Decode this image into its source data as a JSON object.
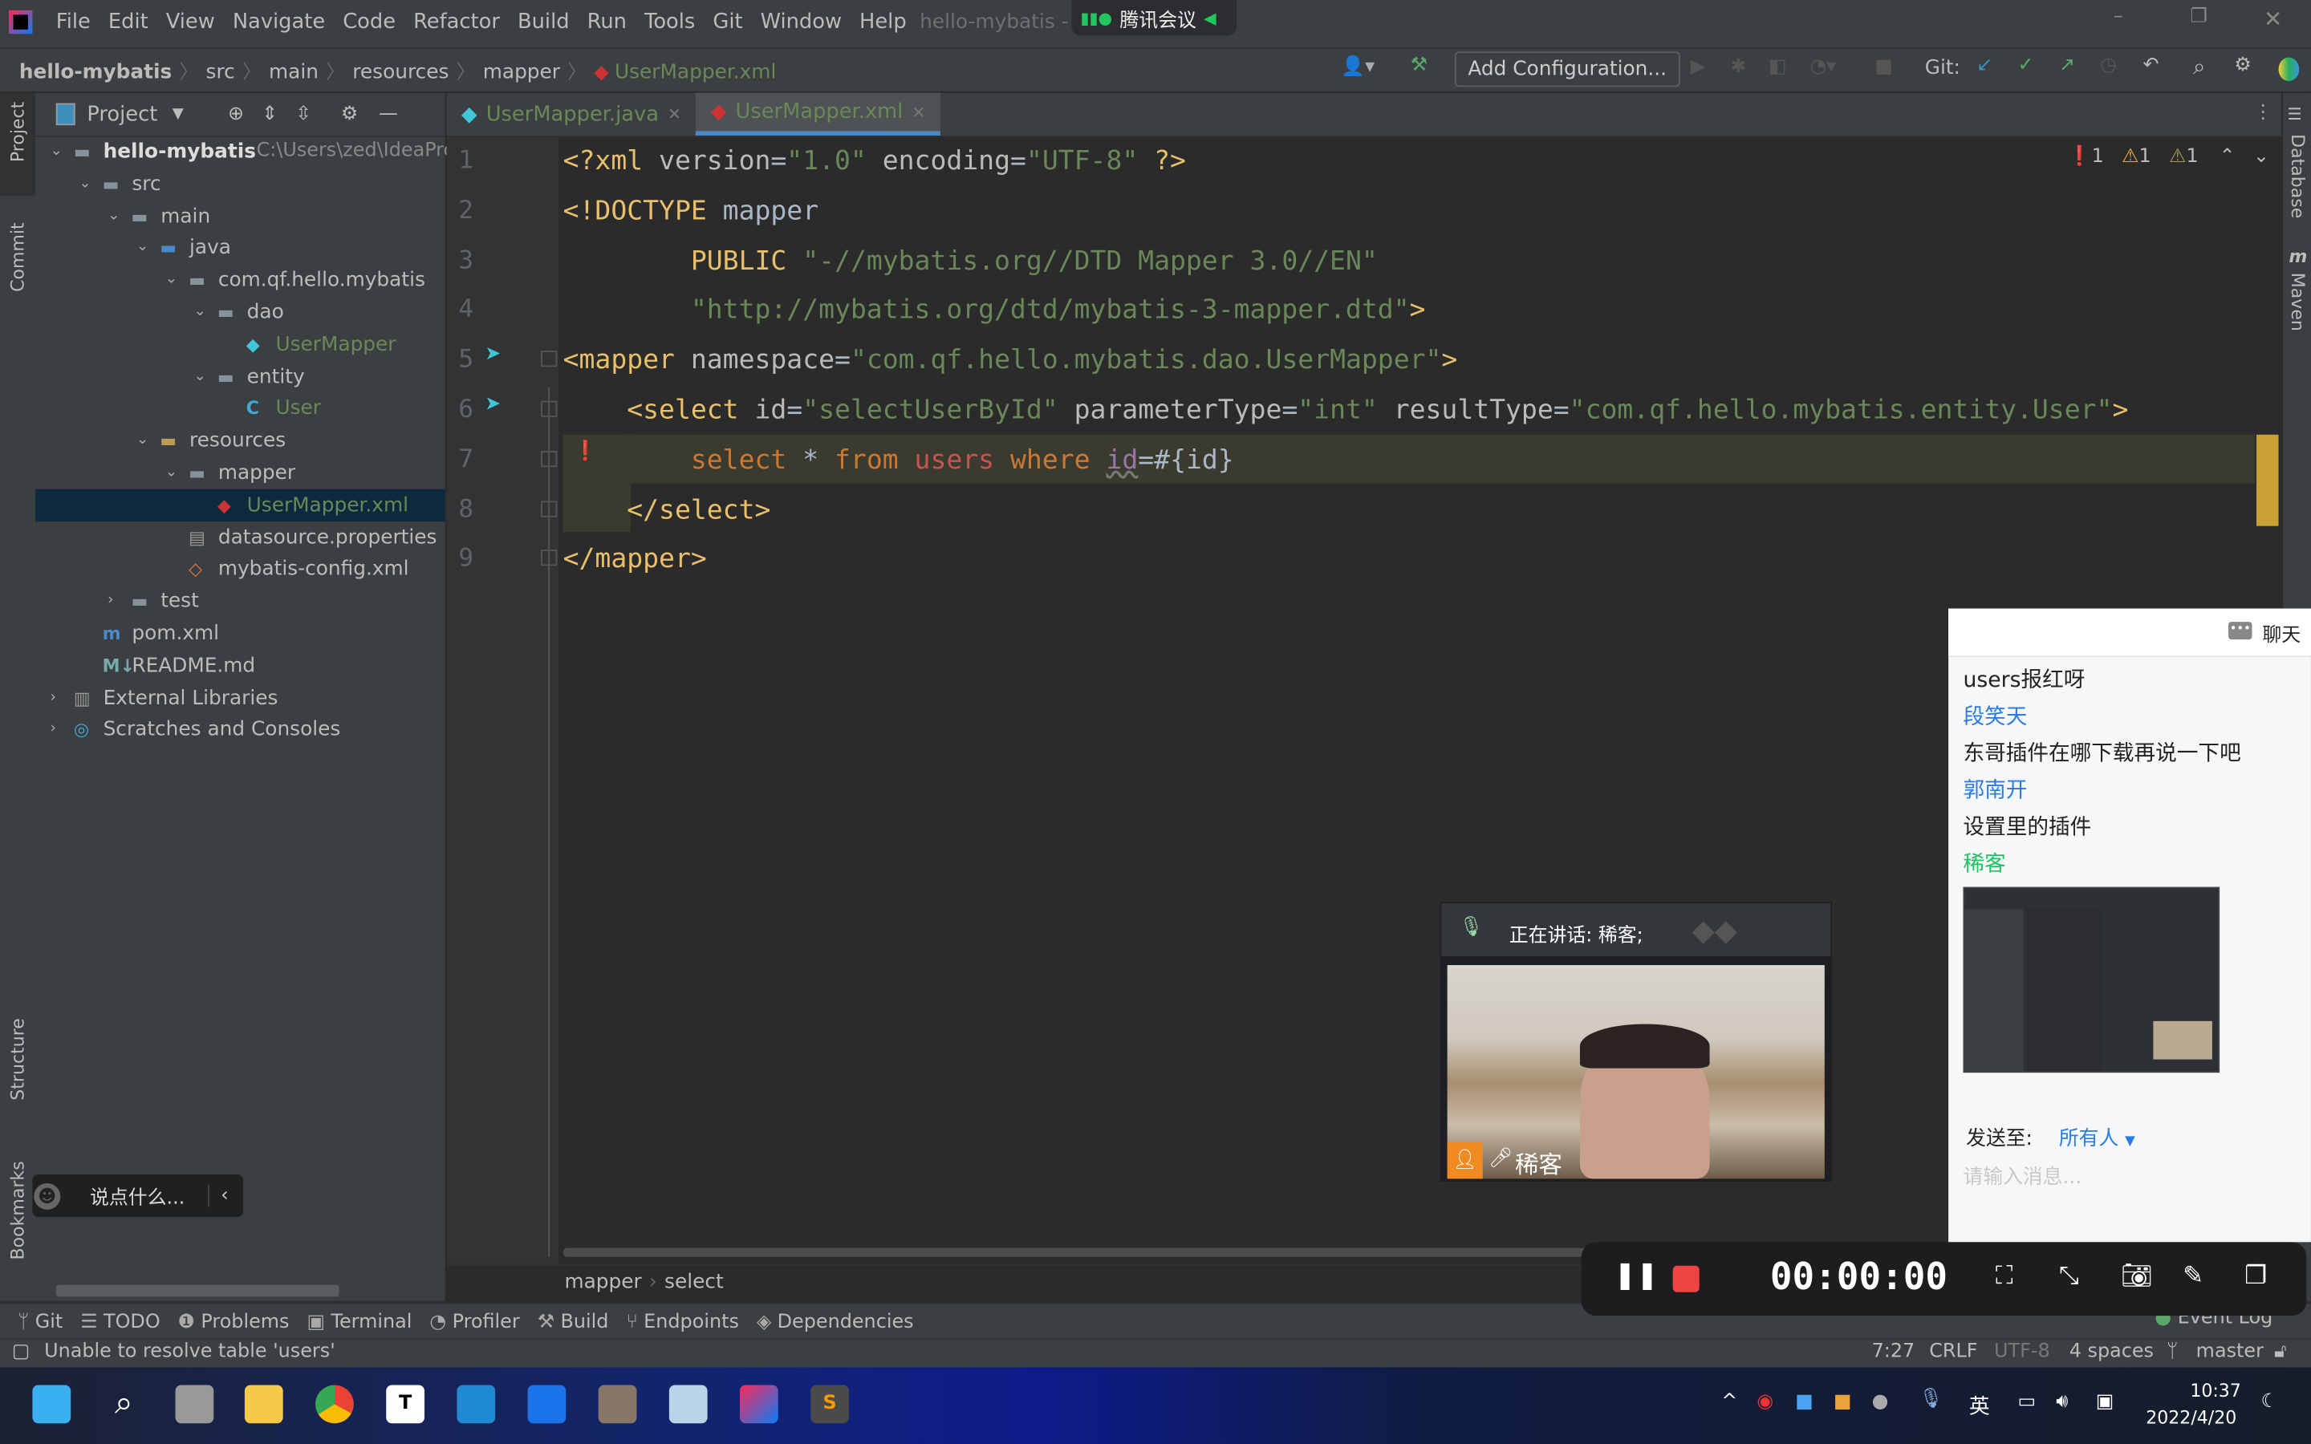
{
  "titlebar": {
    "menu": [
      "File",
      "Edit",
      "View",
      "Navigate",
      "Code",
      "Refactor",
      "Build",
      "Run",
      "Tools",
      "Git",
      "Window",
      "Help"
    ],
    "window_title": "hello-mybatis - UserMapper.xml",
    "meeting_app": "腾讯会议"
  },
  "navbar": {
    "breadcrumb": [
      "hello-mybatis",
      "src",
      "main",
      "resources",
      "mapper",
      "UserMapper.xml"
    ],
    "add_configuration": "Add Configuration...",
    "git_label": "Git:"
  },
  "left_stripe": {
    "project": "Project",
    "commit": "Commit",
    "structure": "Structure",
    "bookmarks": "Bookmarks"
  },
  "right_stripe": {
    "database": "Database",
    "maven": "Maven"
  },
  "project_panel": {
    "title": "Project",
    "tree": [
      {
        "label": "hello-mybatis",
        "extra": "C:\\Users\\zed\\IdeaProjec",
        "depth": 0,
        "arrow": "down",
        "icon": "folder-icon",
        "bold": true
      },
      {
        "label": "src",
        "depth": 1,
        "arrow": "down",
        "icon": "folder-icon"
      },
      {
        "label": "main",
        "depth": 2,
        "arrow": "down",
        "icon": "folder-icon"
      },
      {
        "label": "java",
        "depth": 3,
        "arrow": "down",
        "icon": "source-folder-icon"
      },
      {
        "label": "com.qf.hello.mybatis",
        "depth": 4,
        "arrow": "down",
        "icon": "package-icon"
      },
      {
        "label": "dao",
        "depth": 5,
        "arrow": "down",
        "icon": "package-icon"
      },
      {
        "label": "UserMapper",
        "depth": 6,
        "icon": "mybatis-icon",
        "color": "#6a8759"
      },
      {
        "label": "entity",
        "depth": 5,
        "arrow": "down",
        "icon": "package-icon"
      },
      {
        "label": "User",
        "depth": 6,
        "icon": "class-icon",
        "color": "#6a8759"
      },
      {
        "label": "resources",
        "depth": 3,
        "arrow": "down",
        "icon": "resources-folder-icon"
      },
      {
        "label": "mapper",
        "depth": 4,
        "arrow": "down",
        "icon": "folder-icon"
      },
      {
        "label": "UserMapper.xml",
        "depth": 5,
        "icon": "mybatis-xml-icon",
        "color": "#6a8759",
        "selected": true
      },
      {
        "label": "datasource.properties",
        "depth": 4,
        "icon": "properties-icon"
      },
      {
        "label": "mybatis-config.xml",
        "depth": 4,
        "icon": "xml-icon"
      },
      {
        "label": "test",
        "depth": 2,
        "arrow": "right",
        "icon": "folder-icon"
      },
      {
        "label": "pom.xml",
        "depth": 1,
        "icon": "maven-icon"
      },
      {
        "label": "README.md",
        "depth": 1,
        "icon": "markdown-icon"
      },
      {
        "label": "External Libraries",
        "depth": 0,
        "arrow": "right",
        "icon": "libraries-icon"
      },
      {
        "label": "Scratches and Consoles",
        "depth": 0,
        "arrow": "right",
        "icon": "scratches-icon"
      }
    ]
  },
  "editor": {
    "tabs": [
      {
        "label": "UserMapper.java",
        "active": false
      },
      {
        "label": "UserMapper.xml",
        "active": true
      }
    ],
    "inspections": {
      "errors": "1",
      "warnings": "1",
      "weak_warnings": "1"
    },
    "lines": [
      [
        [
          "t-tag",
          "<?xml "
        ],
        [
          "t-attr",
          "version"
        ],
        [
          "t-txt",
          "="
        ],
        [
          "t-val",
          "\"1.0\""
        ],
        [
          "t-attr",
          " encoding"
        ],
        [
          "t-txt",
          "="
        ],
        [
          "t-val",
          "\"UTF-8\""
        ],
        [
          "t-tag",
          " ?>"
        ]
      ],
      [
        [
          "t-tag",
          "<!DOCTYPE "
        ],
        [
          "t-txt",
          "mapper"
        ]
      ],
      [
        [
          "t-tag",
          "        PUBLIC "
        ],
        [
          "t-val",
          "\"-//mybatis.org//DTD Mapper 3.0//EN\""
        ]
      ],
      [
        [
          "t-val",
          "        \"http://mybatis.org/dtd/mybatis-3-mapper.dtd\""
        ],
        [
          "t-tag",
          ">"
        ]
      ],
      [
        [
          "t-tag",
          "<mapper "
        ],
        [
          "t-attr",
          "namespace"
        ],
        [
          "t-txt",
          "="
        ],
        [
          "t-val",
          "\"com.qf.hello.mybatis.dao.UserMapper\""
        ],
        [
          "t-tag",
          ">"
        ]
      ],
      [
        [
          "t-tag",
          "    <select "
        ],
        [
          "t-attr",
          "id"
        ],
        [
          "t-txt",
          "="
        ],
        [
          "t-val",
          "\"selectUserById\""
        ],
        [
          "t-attr",
          " parameterType"
        ],
        [
          "t-txt",
          "="
        ],
        [
          "t-val",
          "\"int\""
        ],
        [
          "t-attr",
          " resultType"
        ],
        [
          "t-txt",
          "="
        ],
        [
          "t-val",
          "\"com.qf.hello.mybatis.entity.User\""
        ],
        [
          "t-tag",
          ">"
        ]
      ],
      [
        [
          "t-kw",
          "        select "
        ],
        [
          "t-txt",
          "* "
        ],
        [
          "t-kw",
          "from "
        ],
        [
          "t-err",
          "users "
        ],
        [
          "t-kw",
          "where "
        ],
        [
          "t-id",
          "id"
        ],
        [
          "t-txt",
          "=#{id}"
        ]
      ],
      [
        [
          "t-tag",
          "    </select>"
        ]
      ],
      [
        [
          "t-tag",
          "</mapper>"
        ]
      ]
    ],
    "breadcrumb": [
      "mapper",
      "select"
    ]
  },
  "tool_windows": [
    "Git",
    "TODO",
    "Problems",
    "Terminal",
    "Profiler",
    "Build",
    "Endpoints",
    "Dependencies"
  ],
  "event_log": "Event Log",
  "status": {
    "message": "Unable to resolve table 'users'",
    "position": "7:27",
    "line_sep": "CRLF",
    "encoding": "UTF-8",
    "indent": "4 spaces",
    "branch": "master"
  },
  "danmaku": {
    "placeholder": "说点什么..."
  },
  "chat": {
    "title": "聊天",
    "messages": [
      {
        "text": "users报红呀",
        "kind": "msg"
      },
      {
        "text": "段笑天",
        "kind": "sender"
      },
      {
        "text": "东哥插件在哪下载再说一下吧",
        "kind": "msg"
      },
      {
        "text": "郭南开",
        "kind": "sender"
      },
      {
        "text": "设置里的插件",
        "kind": "msg"
      },
      {
        "text": "稀客",
        "kind": "self"
      }
    ],
    "send_to_label": "发送至:",
    "send_to_value": "所有人",
    "input_placeholder": "请输入消息..."
  },
  "video": {
    "speaking": "正在讲话: 稀客;",
    "name": "稀客"
  },
  "recording": {
    "timer": "00:00:00"
  },
  "taskbar": {
    "ime": "英",
    "time": "10:37",
    "date": "2022/4/20"
  },
  "colors": {
    "accent": "#4a88c7",
    "editor_bg": "#2b2b2b",
    "panel_bg": "#3c3f41",
    "string": "#6a8759",
    "tag": "#e8bf6a",
    "keyword": "#cc7832",
    "error": "#c75450",
    "meeting_green": "#22c55e"
  }
}
